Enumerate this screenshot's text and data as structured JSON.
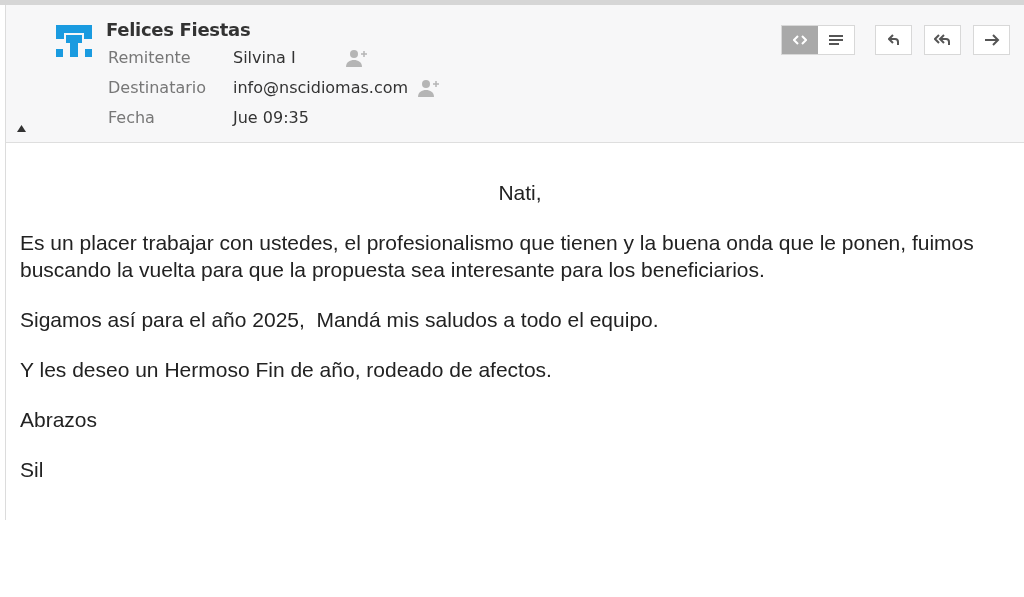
{
  "message": {
    "subject": "Felices Fiestas",
    "fields": [
      {
        "label": "Remitente",
        "value": "Silvina I",
        "add_contact": true
      },
      {
        "label": "Destinatario",
        "value": "info@nscidiomas.com",
        "add_contact": true
      },
      {
        "label": "Fecha",
        "value": "Jue 09:35",
        "add_contact": false
      }
    ],
    "header_expanded": true,
    "view_modes": [
      {
        "kind": "html",
        "selected": true
      },
      {
        "kind": "text",
        "selected": false
      }
    ],
    "actions": [
      {
        "kind": "reply"
      },
      {
        "kind": "reply_all"
      },
      {
        "kind": "forward"
      }
    ],
    "greeting": "Nati,",
    "paragraphs": [
      "Es un placer trabajar con ustedes, el profesionalismo que tienen y la buena onda que le ponen, fuimos buscando la vuelta para que la propuesta sea interesante para los beneficiarios.",
      "Sigamos así para el año 2025,  Mandá mis saludos a todo el equipo.",
      "Y les deseo un Hermoso Fin de año, rodeado de afectos.",
      "Abrazos",
      "Sil"
    ]
  }
}
